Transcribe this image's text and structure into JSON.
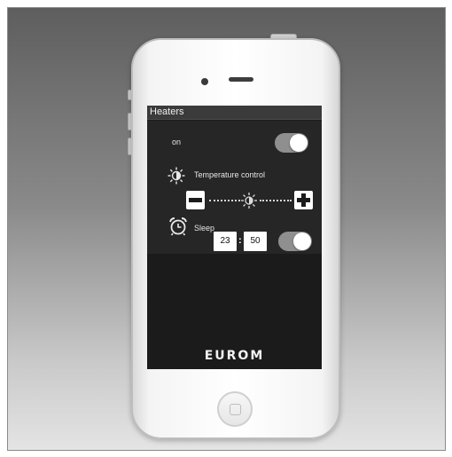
{
  "app": {
    "title": "Heaters",
    "brand": "EUROM"
  },
  "power": {
    "label": "on",
    "enabled": true
  },
  "temperature": {
    "label": "Temperature control",
    "decrease_icon": "minus-icon",
    "increase_icon": "plus-icon",
    "level_icon": "sun-icon"
  },
  "sleep": {
    "label": "Sleep",
    "hours": "23",
    "minutes": "50",
    "separator": ":",
    "enabled": true,
    "icon": "alarm-clock-icon"
  },
  "colors": {
    "screen_bg": "#1b1b1b",
    "panel_bg": "#262626",
    "toggle_track": "#8f8f8f",
    "toggle_knob": "#ffffff"
  }
}
